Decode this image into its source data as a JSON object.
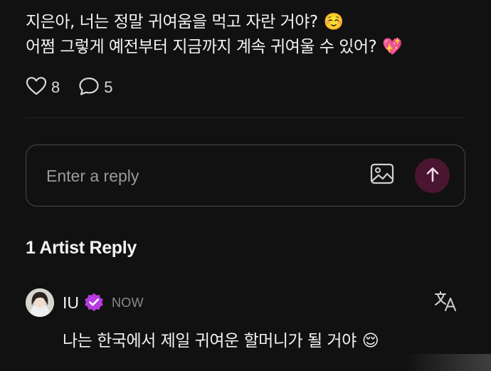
{
  "post": {
    "line1": "지은아, 너는 정말 귀여움을 먹고 자란 거야?",
    "line1_emoji": "☺️",
    "line2": "어쩜 그렇게 예전부터 지금까지 계속 귀여울 수 있어?",
    "line2_emoji": "💖"
  },
  "actions": {
    "likes": "8",
    "comments": "5"
  },
  "reply_box": {
    "placeholder": "Enter a reply"
  },
  "artist_replies": {
    "title": "1 Artist Reply",
    "reply": {
      "name": "IU",
      "time": "NOW",
      "text": "나는 한국에서 제일 귀여운 할머니가 될 거야",
      "emoji": "😌"
    }
  },
  "colors": {
    "background": "#111111",
    "send_button": "#4a1530",
    "verified_badge": "#b63be0"
  },
  "icons": {
    "like": "heart-outline-icon",
    "comment": "speech-bubble-icon",
    "image": "image-icon",
    "send": "arrow-up-icon",
    "verified": "verified-badge-icon",
    "translate": "translate-icon"
  }
}
